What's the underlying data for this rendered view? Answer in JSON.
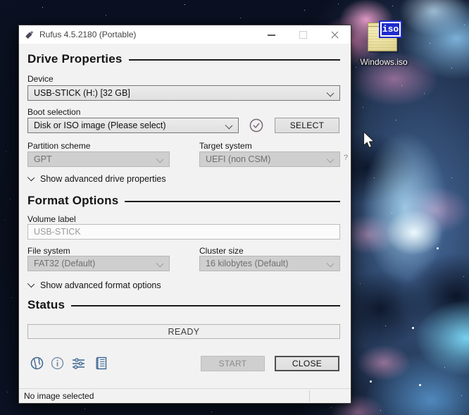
{
  "desktop": {
    "icon": {
      "label": "Windows.iso",
      "badge": "iso"
    }
  },
  "window": {
    "title": "Rufus 4.5.2180 (Portable)",
    "titlebar_icons": [
      "usb-drive-icon",
      "minimize-icon",
      "maximize-icon",
      "close-icon"
    ],
    "drive": {
      "heading": "Drive Properties",
      "device_label": "Device",
      "device_value": "USB-STICK (H:) [32 GB]",
      "boot_label": "Boot selection",
      "boot_value": "Disk or ISO image (Please select)",
      "select_button": "SELECT",
      "partition_label": "Partition scheme",
      "partition_value": "GPT",
      "target_label": "Target system",
      "target_value": "UEFI (non CSM)",
      "target_help": "?",
      "advanced_toggle": "Show advanced drive properties"
    },
    "format": {
      "heading": "Format Options",
      "volume_label": "Volume label",
      "volume_value": "USB-STICK",
      "filesystem_label": "File system",
      "filesystem_value": "FAT32 (Default)",
      "cluster_label": "Cluster size",
      "cluster_value": "16 kilobytes (Default)",
      "advanced_toggle": "Show advanced format options"
    },
    "status": {
      "heading": "Status",
      "progress_text": "READY"
    },
    "footer": {
      "icons": [
        "globe-icon",
        "info-icon",
        "settings-sliders-icon",
        "log-icon"
      ],
      "start_button": "START",
      "close_button": "CLOSE"
    },
    "statusbar_text": "No image selected"
  },
  "colors": {
    "footer_icon_blue": "#3a648f",
    "iso_badge_blue": "#1f2ccd",
    "folder_yellow": "#ece2a2",
    "check_circle_gray": "#7b6a79",
    "nebula_pink": "#e79fc9",
    "nebula_blue": "#7fb8e6"
  }
}
